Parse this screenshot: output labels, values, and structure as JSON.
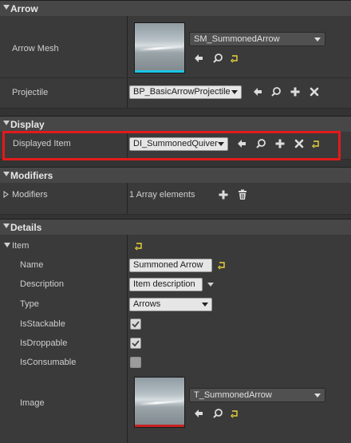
{
  "colors": {
    "section_bg": "#474747",
    "row_bg": "#3a3a3a",
    "highlight": "#e21a1a",
    "mesh_bar": "#18c6e6",
    "texture_bar": "#c62222",
    "reset_icon": "#e8d53a"
  },
  "sections": {
    "arrow": "Arrow",
    "display": "Display",
    "modifiers": "Modifiers",
    "details": "Details"
  },
  "arrow": {
    "mesh_label": "Arrow Mesh",
    "mesh_value": "SM_SummonedArrow",
    "projectile_label": "Projectile",
    "projectile_value": "BP_BasicArrowProjectile"
  },
  "display": {
    "item_label": "Displayed Item",
    "item_value": "DI_SummonedQuiver"
  },
  "modifiers": {
    "label": "Modifiers",
    "count": "1 Array elements"
  },
  "details": {
    "item_label": "Item",
    "name_label": "Name",
    "name_value": "Summoned Arrow",
    "description_label": "Description",
    "description_value": "Item description",
    "type_label": "Type",
    "type_value": "Arrows",
    "stackable_label": "IsStackable",
    "stackable_checked": true,
    "droppable_label": "IsDroppable",
    "droppable_checked": true,
    "consumable_label": "IsConsumable",
    "consumable_checked": false,
    "image_label": "Image",
    "image_value": "T_SummonedArrow"
  },
  "icons": {
    "use_selected": "arrow-left-icon",
    "browse": "magnifier-icon",
    "add": "plus-icon",
    "clear": "x-icon",
    "reset": "reset-arrow-icon",
    "delete": "trash-icon"
  }
}
